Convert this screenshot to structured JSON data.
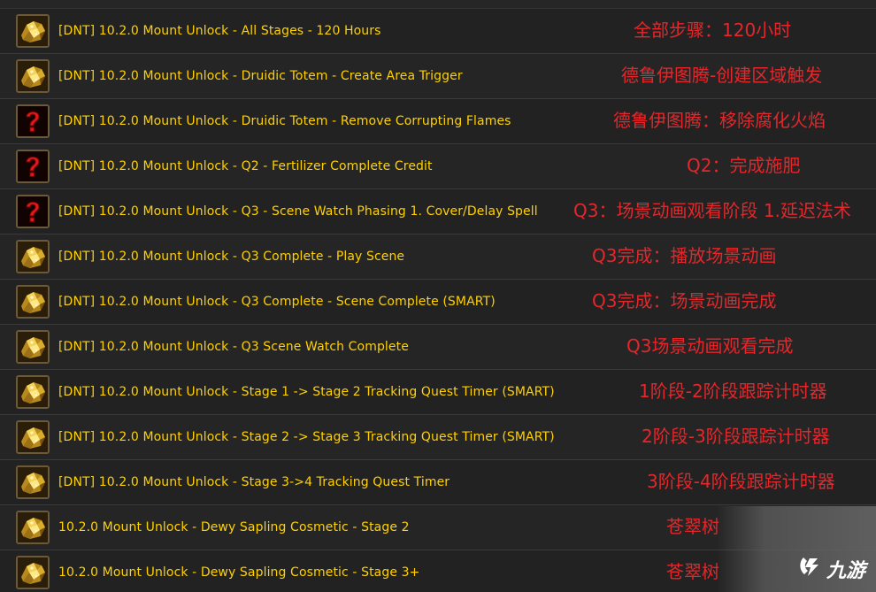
{
  "spell_list": {
    "rows": [
      {
        "name": "[DNT] 10.2.0 Mount Unlock - All Stages - 120 Hours",
        "translation": "全部步骤：120小时",
        "icon": "gold-ore-icon"
      },
      {
        "name": "[DNT] 10.2.0 Mount Unlock - Druidic Totem - Create Area Trigger",
        "translation": "德鲁伊图腾-创建区域触发",
        "icon": "gold-ore-icon"
      },
      {
        "name": "[DNT] 10.2.0 Mount Unlock - Druidic Totem - Remove Corrupting Flames",
        "translation": "德鲁伊图腾：移除腐化火焰",
        "icon": "question-mark-icon"
      },
      {
        "name": "[DNT] 10.2.0 Mount Unlock - Q2 - Fertilizer Complete Credit",
        "translation": "Q2：完成施肥",
        "icon": "question-mark-icon"
      },
      {
        "name": "[DNT] 10.2.0 Mount Unlock - Q3 - Scene Watch Phasing 1. Cover/Delay Spell",
        "translation": "Q3：场景动画观看阶段 1.延迟法术",
        "icon": "question-mark-icon"
      },
      {
        "name": "[DNT] 10.2.0 Mount Unlock - Q3 Complete - Play Scene",
        "translation": "Q3完成：播放场景动画",
        "icon": "gold-ore-icon"
      },
      {
        "name": "[DNT] 10.2.0 Mount Unlock - Q3 Complete - Scene Complete (SMART)",
        "translation": "Q3完成：场景动画完成",
        "icon": "gold-ore-icon"
      },
      {
        "name": "[DNT] 10.2.0 Mount Unlock - Q3 Scene Watch Complete",
        "translation": "Q3场景动画观看完成",
        "icon": "gold-ore-icon"
      },
      {
        "name": "[DNT] 10.2.0 Mount Unlock - Stage 1 -> Stage 2 Tracking Quest Timer (SMART)",
        "translation": "1阶段-2阶段跟踪计时器",
        "icon": "gold-ore-icon"
      },
      {
        "name": "[DNT] 10.2.0 Mount Unlock - Stage 2 -> Stage 3 Tracking Quest Timer (SMART)",
        "translation": "2阶段-3阶段跟踪计时器",
        "icon": "gold-ore-icon"
      },
      {
        "name": "[DNT] 10.2.0 Mount Unlock - Stage 3->4 Tracking Quest Timer",
        "translation": "3阶段-4阶段跟踪计时器",
        "icon": "gold-ore-icon"
      },
      {
        "name": "10.2.0 Mount Unlock - Dewy Sapling Cosmetic - Stage 2",
        "translation": "苍翠树",
        "icon": "gold-ore-icon"
      },
      {
        "name": "10.2.0 Mount Unlock - Dewy Sapling Cosmetic - Stage 3+",
        "translation": "苍翠树",
        "icon": "gold-ore-icon"
      }
    ]
  },
  "watermark": {
    "text": "九游",
    "icon": "jiuyou-logo-icon"
  },
  "colors": {
    "spell_name": "#ffd100",
    "translation": "#e3272b",
    "background": "#1e1e1e"
  }
}
